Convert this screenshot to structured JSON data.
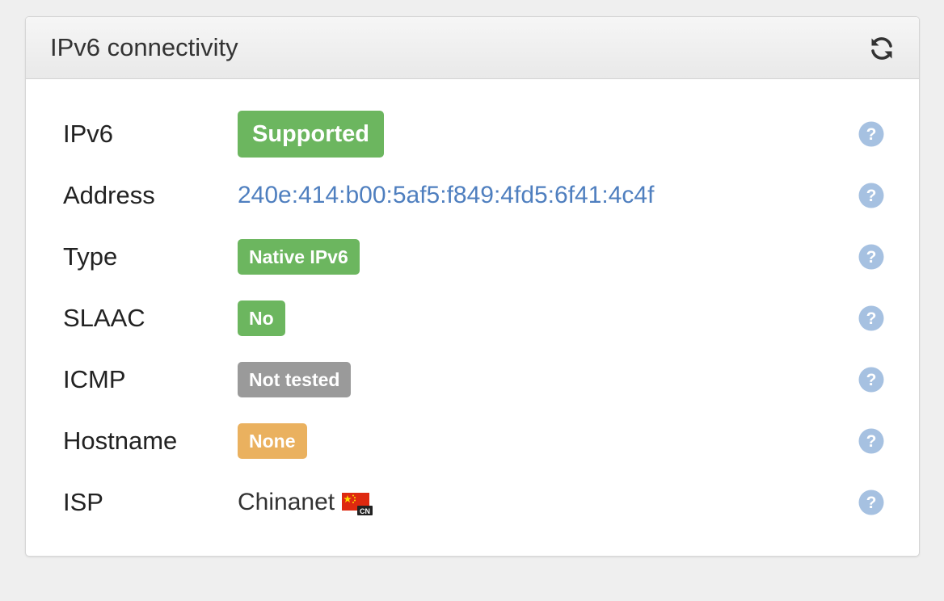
{
  "panel": {
    "title": "IPv6 connectivity",
    "refresh_icon": "refresh-icon"
  },
  "rows": [
    {
      "label": "IPv6",
      "value": "Supported",
      "kind": "badge-big",
      "color": "#6cb65f"
    },
    {
      "label": "Address",
      "value": "240e:414:b00:5af5:f849:4fd5:6f41:4c4f",
      "kind": "link",
      "color": "#4f7fbf"
    },
    {
      "label": "Type",
      "value": "Native IPv6",
      "kind": "badge",
      "color": "#6cb65f"
    },
    {
      "label": "SLAAC",
      "value": "No",
      "kind": "badge",
      "color": "#6cb65f"
    },
    {
      "label": "ICMP",
      "value": "Not tested",
      "kind": "badge",
      "color": "#9a9a9a"
    },
    {
      "label": "Hostname",
      "value": "None",
      "kind": "badge",
      "color": "#eab15f"
    },
    {
      "label": "ISP",
      "value": "Chinanet",
      "kind": "text",
      "flag": "CN"
    }
  ],
  "help_icon": "question-circle-icon"
}
